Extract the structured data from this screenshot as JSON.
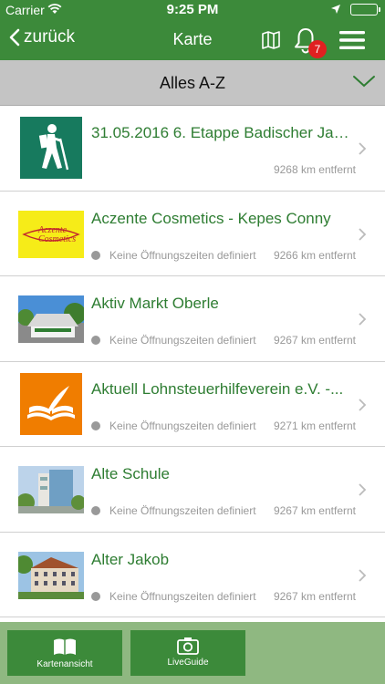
{
  "status": {
    "carrier": "Carrier",
    "time": "9:25 PM"
  },
  "nav": {
    "back_label": "zurück",
    "title": "Karte",
    "notification_count": "7"
  },
  "filter": {
    "label": "Alles A-Z"
  },
  "items": [
    {
      "name": "31.05.2016 6. Etappe Badischer Jak...",
      "hours": "",
      "distance": "9268 km entfernt"
    },
    {
      "name": "Aczente Cosmetics - Kepes Conny",
      "hours": "Keine Öffnungszeiten definiert",
      "distance": "9266 km entfernt",
      "logo_text_1": "Aczente",
      "logo_text_2": "Cosmetics"
    },
    {
      "name": "Aktiv Markt Oberle",
      "hours": "Keine Öffnungszeiten definiert",
      "distance": "9267 km entfernt"
    },
    {
      "name": "Aktuell Lohnsteuerhilfeverein e.V. -...",
      "hours": "Keine Öffnungszeiten definiert",
      "distance": "9271 km entfernt"
    },
    {
      "name": "Alte Schule",
      "hours": "Keine Öffnungszeiten definiert",
      "distance": "9267 km entfernt"
    },
    {
      "name": "Alter Jakob",
      "hours": "Keine Öffnungszeiten definiert",
      "distance": "9267 km entfernt"
    }
  ],
  "bottom": {
    "tab1_label": "Kartenansicht",
    "tab2_label": "LiveGuide"
  },
  "colors": {
    "brand": "#3c8a3a",
    "text_green": "#2e7d32",
    "badge": "#e02020",
    "bottom_bg": "#8fb881"
  }
}
